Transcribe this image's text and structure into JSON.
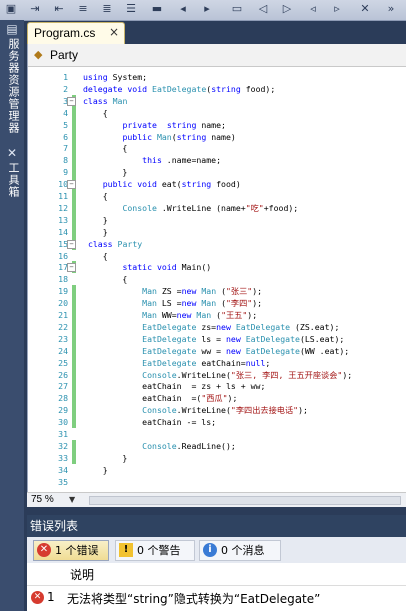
{
  "toolbar": {
    "buttons": [
      "save-icon",
      "indent-icon",
      "outdent-icon",
      "comment-icon",
      "uncomment-icon",
      "bookmark-icon",
      "prev-bookmark-icon",
      "next-bookmark-icon",
      "clear-bookmark-icon"
    ]
  },
  "sidebar": {
    "tab1": "服务器资源管理器",
    "tab2": "工具箱"
  },
  "editor": {
    "tab_label": "Program.cs",
    "tab_close": "×",
    "nav_class": "Party",
    "zoom": "75 %",
    "lines": [
      "using System;",
      "delegate void EatDelegate(string food);",
      "class Man",
      "    {",
      "        private  string name;",
      "        public Man(string name)",
      "        {",
      "            this .name=name;",
      "        }",
      "    public void eat(string food)",
      "    {",
      "        Console .WriteLine (name+\"吃\"+food);",
      "    }",
      "    }",
      " class Party",
      "    {",
      "        static void Main()",
      "        {",
      "            Man ZS =new Man (\"张三\");",
      "            Man LS =new Man (\"李四\");",
      "            Man WW=new Man (\"王五\");",
      "            EatDelegate zs=new EatDelegate (ZS.eat);",
      "            EatDelegate ls = new EatDelegate(LS.eat);",
      "            EatDelegate ww = new EatDelegate(WW .eat);",
      "            EatDelegate eatChain=null;",
      "            Console.WriteLine(\"张三, 李四, 王五开座谈会\");",
      "            eatChain  = zs + ls + ww;",
      "            eatChain  =(\"西瓜\");",
      "            Console.WriteLine(\"李四出去接电话\");",
      "            eatChain -= ls;",
      "",
      "            Console.ReadLine();",
      "        }",
      "    }",
      ""
    ]
  },
  "error_list": {
    "title": "错误列表",
    "errors_btn": "1 个错误",
    "warnings_btn": "0 个警告",
    "messages_btn": "0 个消息",
    "col_description": "说明",
    "rows": [
      {
        "num": "1",
        "message": "无法将类型“string”隐式转换为“EatDelegate”"
      }
    ]
  },
  "colors": {
    "keyword": "#0000ff",
    "type": "#2b91af",
    "string": "#a31515",
    "line_number": "#2b91af",
    "changed": "#7fce7f",
    "error": "#d63b2f",
    "title_bar": "#2f4361"
  }
}
